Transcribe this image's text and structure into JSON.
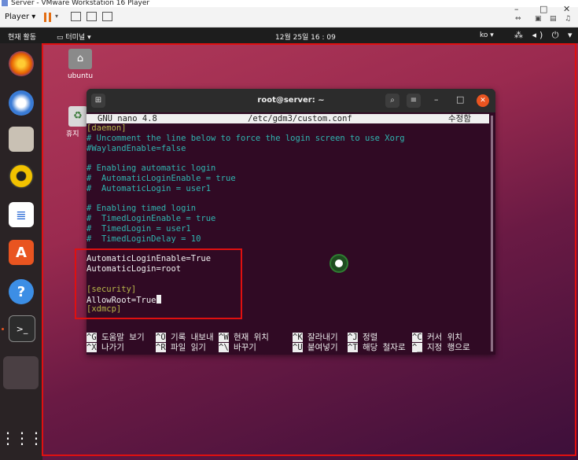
{
  "vmware": {
    "title": "Server - VMware Workstation 16 Player",
    "player_menu": "Player ▾",
    "window_controls": [
      "–",
      "□",
      "✕"
    ]
  },
  "ubuntu": {
    "topbar": {
      "activities": "현재 활동",
      "app_menu": "터미널 ▾",
      "clock": "12월 25일  16 : 09",
      "input_method": "ko ▾",
      "system_icons": "⁂ ◂) ⏻ ▾"
    },
    "desktop_icons": [
      {
        "label": "ubuntu",
        "icon": "home-folder-icon"
      },
      {
        "label": "휴지",
        "icon": "trash-icon"
      }
    ],
    "dock": [
      {
        "name": "firefox",
        "icon": "firefox-icon"
      },
      {
        "name": "thunderbird",
        "icon": "mail-icon"
      },
      {
        "name": "files",
        "icon": "files-icon"
      },
      {
        "name": "rhythmbox",
        "icon": "speaker-icon"
      },
      {
        "name": "writer",
        "icon": "document-icon"
      },
      {
        "name": "software",
        "icon": "software-icon"
      },
      {
        "name": "help",
        "icon": "help-icon"
      },
      {
        "name": "terminal",
        "icon": "terminal-icon"
      },
      {
        "name": "app-grid",
        "icon": "grid-icon"
      }
    ]
  },
  "terminal": {
    "title": "root@server: ~",
    "nano": {
      "version": "GNU nano 4.8",
      "file": "/etc/gdm3/custom.conf",
      "status": "수정함"
    },
    "lines": [
      {
        "text": "[daemon]",
        "style": "section"
      },
      {
        "text": "# Uncomment the line below to force the login screen to use Xorg",
        "style": "comment"
      },
      {
        "text": "#WaylandEnable=false",
        "style": "comment"
      },
      {
        "text": "",
        "style": "text"
      },
      {
        "text": "# Enabling automatic login",
        "style": "comment"
      },
      {
        "text": "#  AutomaticLoginEnable = true",
        "style": "comment"
      },
      {
        "text": "#  AutomaticLogin = user1",
        "style": "comment"
      },
      {
        "text": "",
        "style": "text"
      },
      {
        "text": "# Enabling timed login",
        "style": "comment"
      },
      {
        "text": "#  TimedLoginEnable = true",
        "style": "comment"
      },
      {
        "text": "#  TimedLogin = user1",
        "style": "comment"
      },
      {
        "text": "#  TimedLoginDelay = 10",
        "style": "comment"
      },
      {
        "text": "",
        "style": "text"
      },
      {
        "text": "AutomaticLoginEnable=True",
        "style": "text"
      },
      {
        "text": "AutomaticLogin=root",
        "style": "text"
      },
      {
        "text": "",
        "style": "text"
      },
      {
        "text": "[security]",
        "style": "section"
      },
      {
        "text": "AllowRoot=True",
        "style": "text",
        "cursor": true
      },
      {
        "text": "[xdmcp]",
        "style": "section"
      }
    ],
    "shortcuts_row1": [
      {
        "key": "^G",
        "label": " 도움말 보기"
      },
      {
        "key": "^O",
        "label": " 기록 내보내"
      },
      {
        "key": "^W",
        "label": " 현재 위치"
      },
      {
        "key": "^K",
        "label": " 잘라내기"
      },
      {
        "key": "^J",
        "label": " 정렬"
      },
      {
        "key": "^C",
        "label": " 커서 위치"
      }
    ],
    "shortcuts_row2": [
      {
        "key": "^X",
        "label": " 나가기"
      },
      {
        "key": "^R",
        "label": " 파일 읽기"
      },
      {
        "key": "^\\",
        "label": " 바꾸기"
      },
      {
        "key": "^U",
        "label": " 붙여넣기"
      },
      {
        "key": "^T",
        "label": " 해당 철자로"
      },
      {
        "key": "^_",
        "label": " 지정 행으로"
      }
    ]
  }
}
